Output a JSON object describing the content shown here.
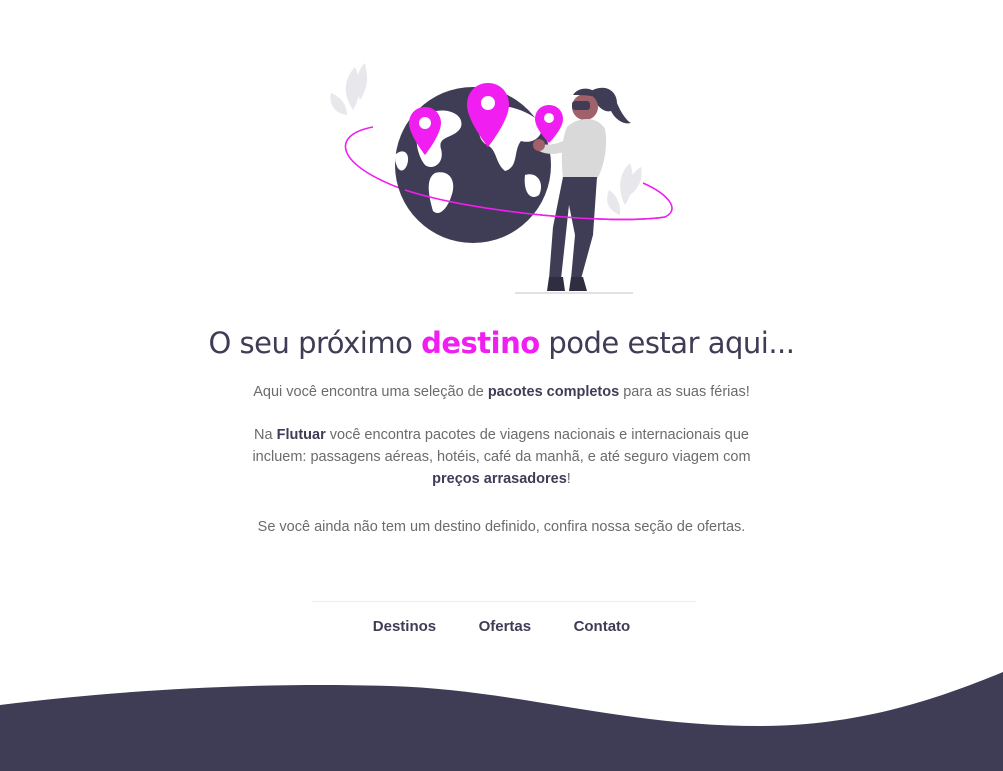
{
  "colors": {
    "accent": "#f01ef0",
    "dark": "#3f3d56",
    "text": "#6b6b6b"
  },
  "illustration": {
    "name": "traveler-with-globe-and-map-pins"
  },
  "headline": {
    "prefix": "O seu próximo ",
    "highlight": "destino",
    "suffix": " pode estar aqui..."
  },
  "intro": {
    "before": "Aqui você encontra uma seleção de ",
    "bold": "pacotes completos",
    "after": " para as suas férias!"
  },
  "about": {
    "before": "Na ",
    "brand": "Flutuar",
    "middle": " você encontra pacotes de viagens nacionais e internacionais que incluem: passagens aéreas, hotéis, café da manhã, e até seguro viagem com ",
    "bold": "preços arrasadores",
    "end": "!"
  },
  "cta_text": "Se você ainda não tem um destino definido, confira nossa seção de ofertas.",
  "nav": {
    "destinos": "Destinos",
    "ofertas": "Ofertas",
    "contato": "Contato"
  }
}
